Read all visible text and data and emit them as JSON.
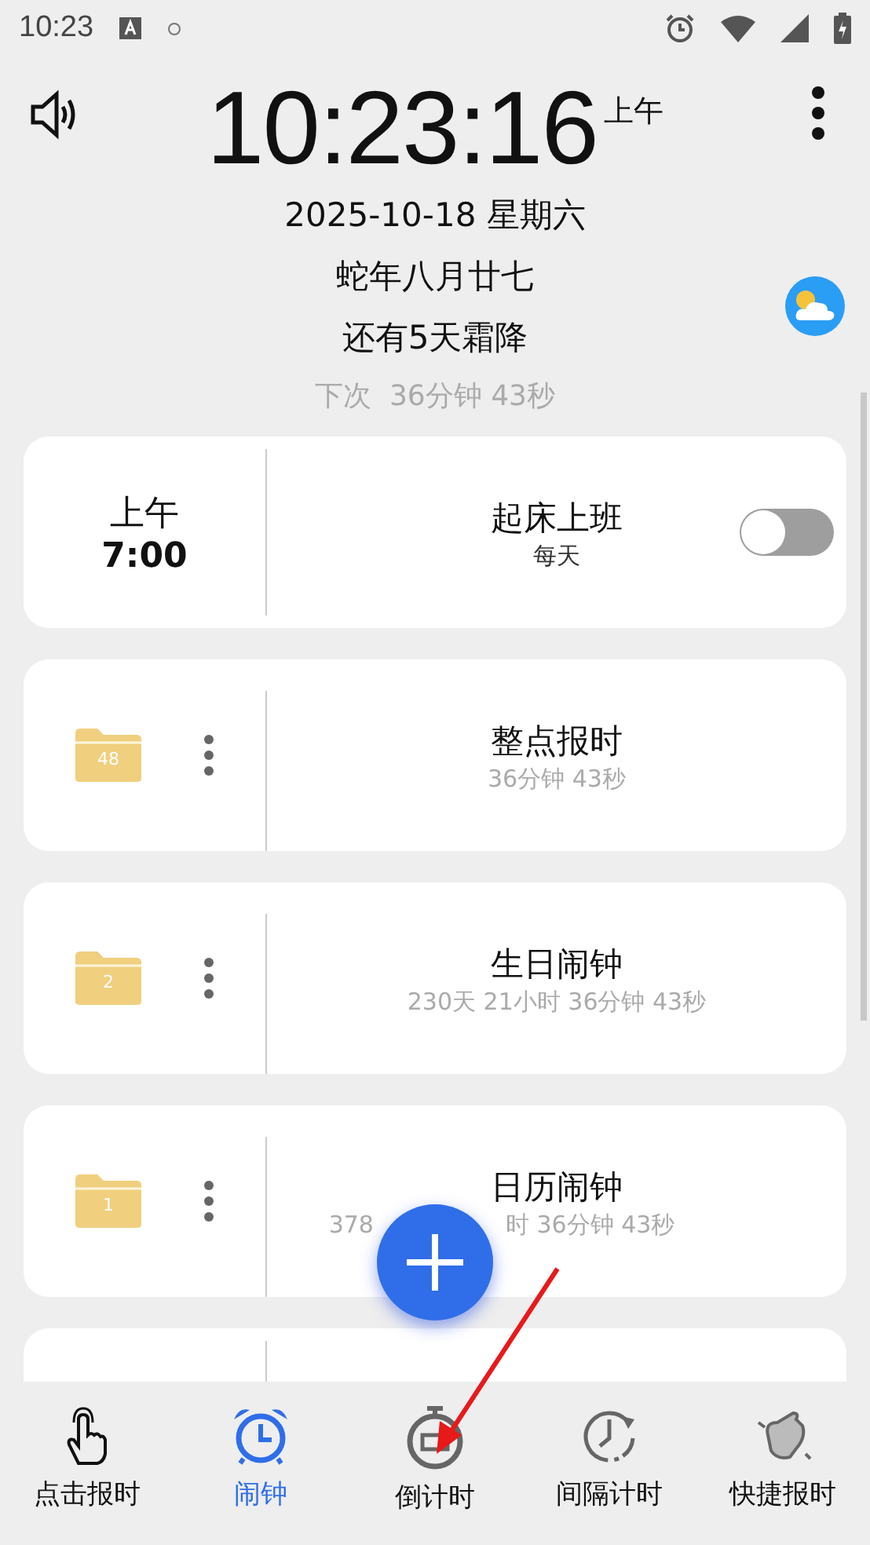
{
  "status_bar": {
    "time": "10:23"
  },
  "header": {
    "time": "10:23:16",
    "ampm": "上午",
    "date": "2025-10-18 星期六",
    "lunar": "蛇年八月廿七",
    "solar_term": "还有5天霜降",
    "next": "下次  36分钟 43秒"
  },
  "alarms": [
    {
      "kind": "alarm",
      "period": "上午",
      "time": "7:00",
      "title": "起床上班",
      "subtitle": "每天",
      "on": false
    },
    {
      "kind": "group",
      "count": "48",
      "title": "整点报时",
      "subtitle": "36分钟 43秒"
    },
    {
      "kind": "group",
      "count": "2",
      "title": "生日闹钟",
      "subtitle": "230天 21小时 36分钟 43秒"
    },
    {
      "kind": "group",
      "count": "1",
      "title": "日历闹钟",
      "subtitle": [
        "378",
        "时 36分钟 43秒"
      ]
    },
    {
      "kind": "empty"
    }
  ],
  "nav": [
    {
      "kind": "tap",
      "label": "点击报时",
      "selected": false
    },
    {
      "kind": "alarm",
      "label": "闹钟",
      "selected": true
    },
    {
      "kind": "countdown",
      "label": "倒计时",
      "selected": false
    },
    {
      "kind": "interval",
      "label": "间隔计时",
      "selected": false
    },
    {
      "kind": "quick",
      "label": "快捷报时",
      "selected": false
    }
  ]
}
